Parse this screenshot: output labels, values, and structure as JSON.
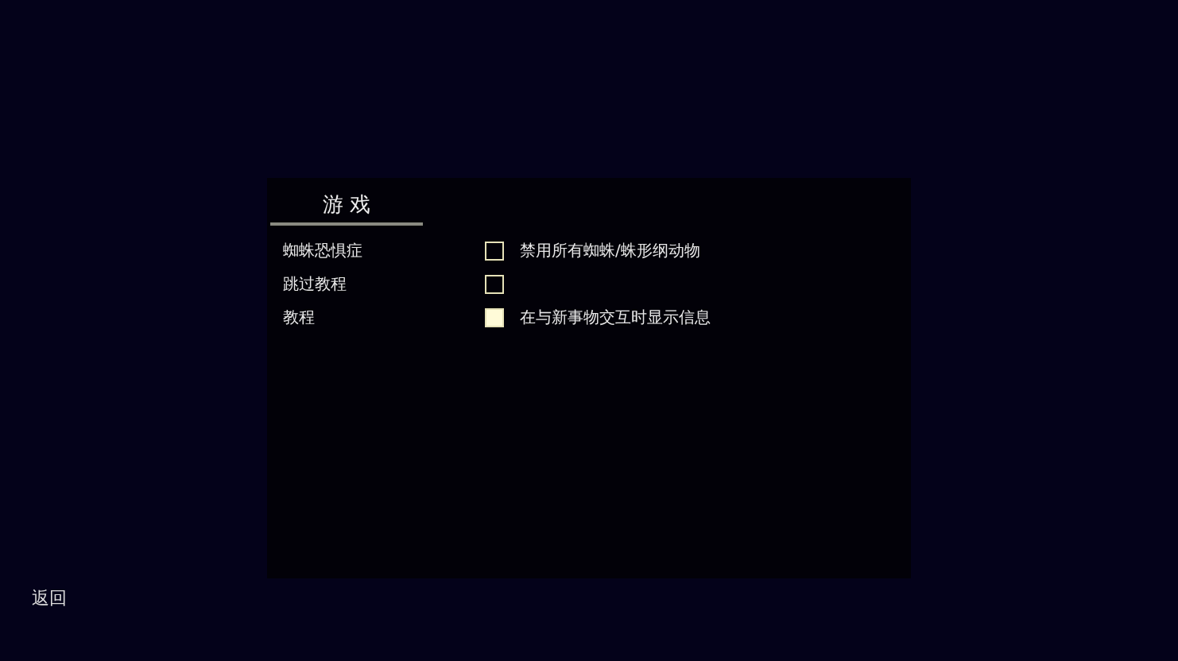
{
  "tab": {
    "label": "游 戏",
    "selected": true
  },
  "settings": [
    {
      "label": "蜘蛛恐惧症",
      "checked": false,
      "description": "禁用所有蜘蛛/蛛形纲动物"
    },
    {
      "label": "跳过教程",
      "checked": false
    },
    {
      "label": "教程",
      "checked": true,
      "description": "在与新事物交互时显示信息"
    }
  ],
  "back_button": "返回"
}
